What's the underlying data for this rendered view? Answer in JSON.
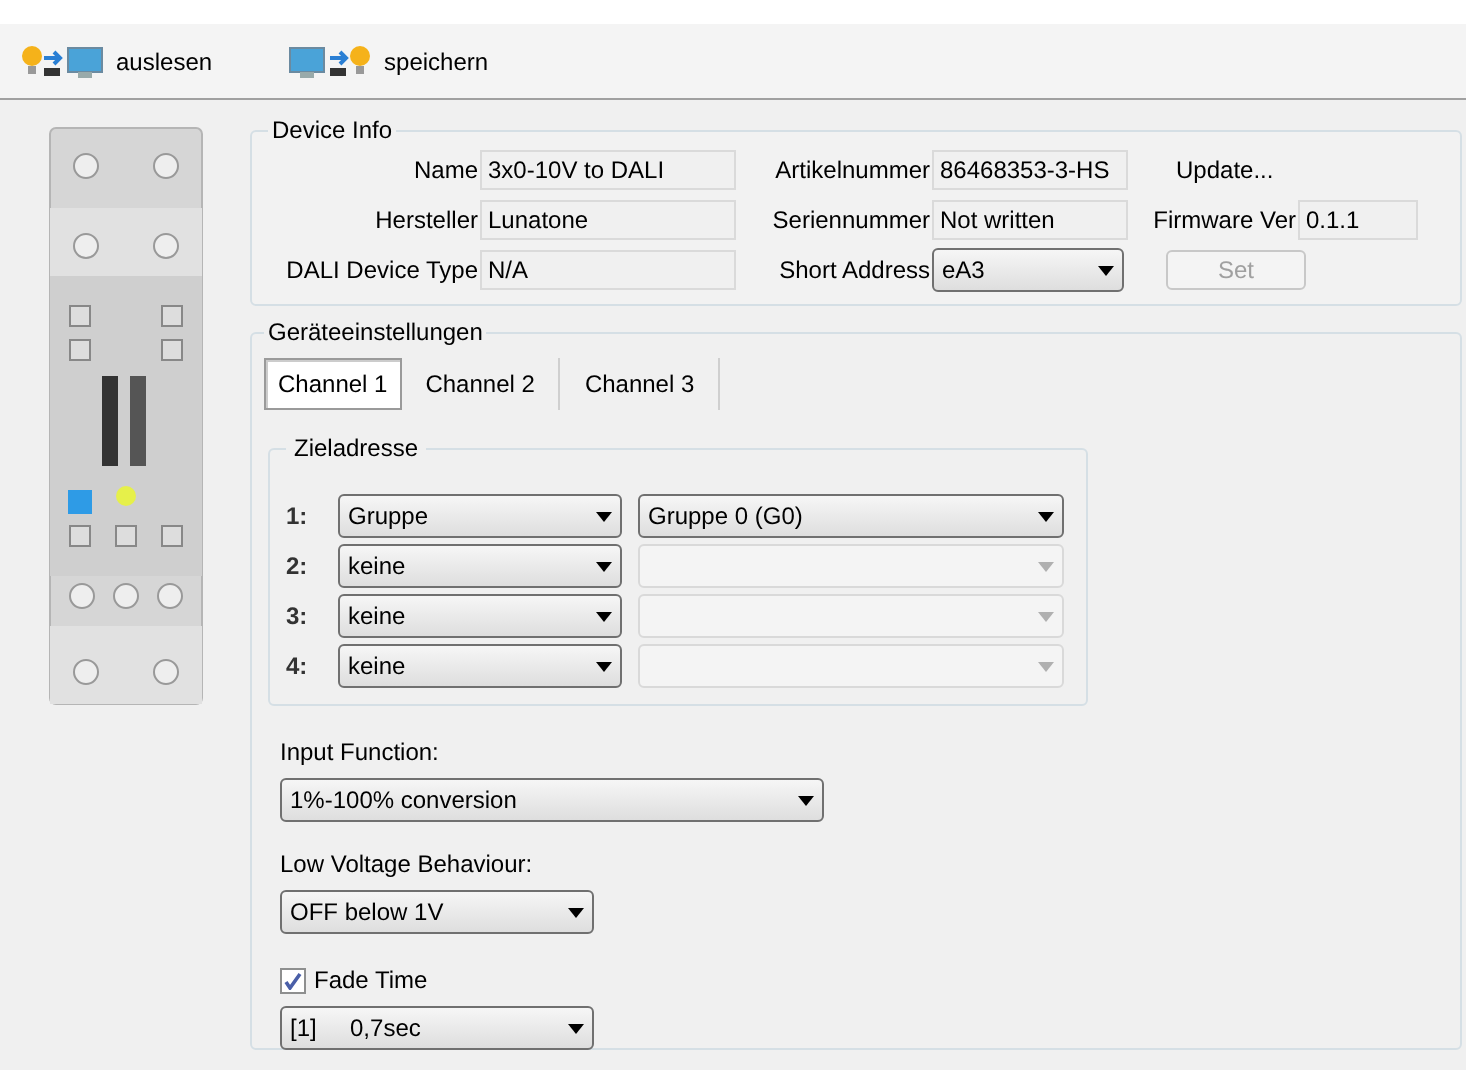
{
  "toolbar": [
    {
      "label": "auslesen",
      "kind": "read"
    },
    {
      "label": "speichern",
      "kind": "write"
    }
  ],
  "device_info": {
    "title": "Device Info",
    "rows": [
      [
        {
          "kind": "field",
          "label": "Name",
          "value": "3x0-10V to DALI"
        },
        {
          "kind": "field",
          "label": "Artikelnummer",
          "value": "86468353-3-HS"
        },
        {
          "kind": "link",
          "label": "Update..."
        }
      ],
      [
        {
          "kind": "field",
          "label": "Hersteller",
          "value": "Lunatone"
        },
        {
          "kind": "field",
          "label": "Seriennummer",
          "value": "Not written"
        },
        {
          "kind": "field",
          "label": "Firmware Ver",
          "value": "0.1.1"
        }
      ],
      [
        {
          "kind": "field",
          "label": "DALI Device Type",
          "value": "N/A"
        },
        {
          "kind": "dropdown",
          "label": "Short Address",
          "value": "eA3"
        },
        {
          "kind": "button",
          "label": "Set",
          "disabled": true
        }
      ]
    ]
  },
  "settings": {
    "title": "Geräteeinstellungen",
    "tabs": [
      {
        "label": "Channel 1",
        "selected": true
      },
      {
        "label": "Channel 2",
        "selected": false
      },
      {
        "label": "Channel 3",
        "selected": false
      }
    ],
    "target": {
      "title": "Zieladresse",
      "rows": [
        {
          "index": "1:",
          "type": "Gruppe",
          "address": "Gruppe 0 (G0)",
          "address_disabled": false
        },
        {
          "index": "2:",
          "type": "keine",
          "address_disabled": true
        },
        {
          "index": "3:",
          "type": "keine",
          "address_disabled": true
        },
        {
          "index": "4:",
          "type": "keine",
          "address_disabled": true
        }
      ]
    },
    "input_function": {
      "label": "Input Function:",
      "value": "1%-100% conversion"
    },
    "low_voltage": {
      "label": "Low Voltage Behaviour:",
      "value": "OFF below 1V"
    },
    "fade_time": {
      "label": "Fade Time",
      "checked": true,
      "value": "[1]     0,7sec"
    }
  }
}
